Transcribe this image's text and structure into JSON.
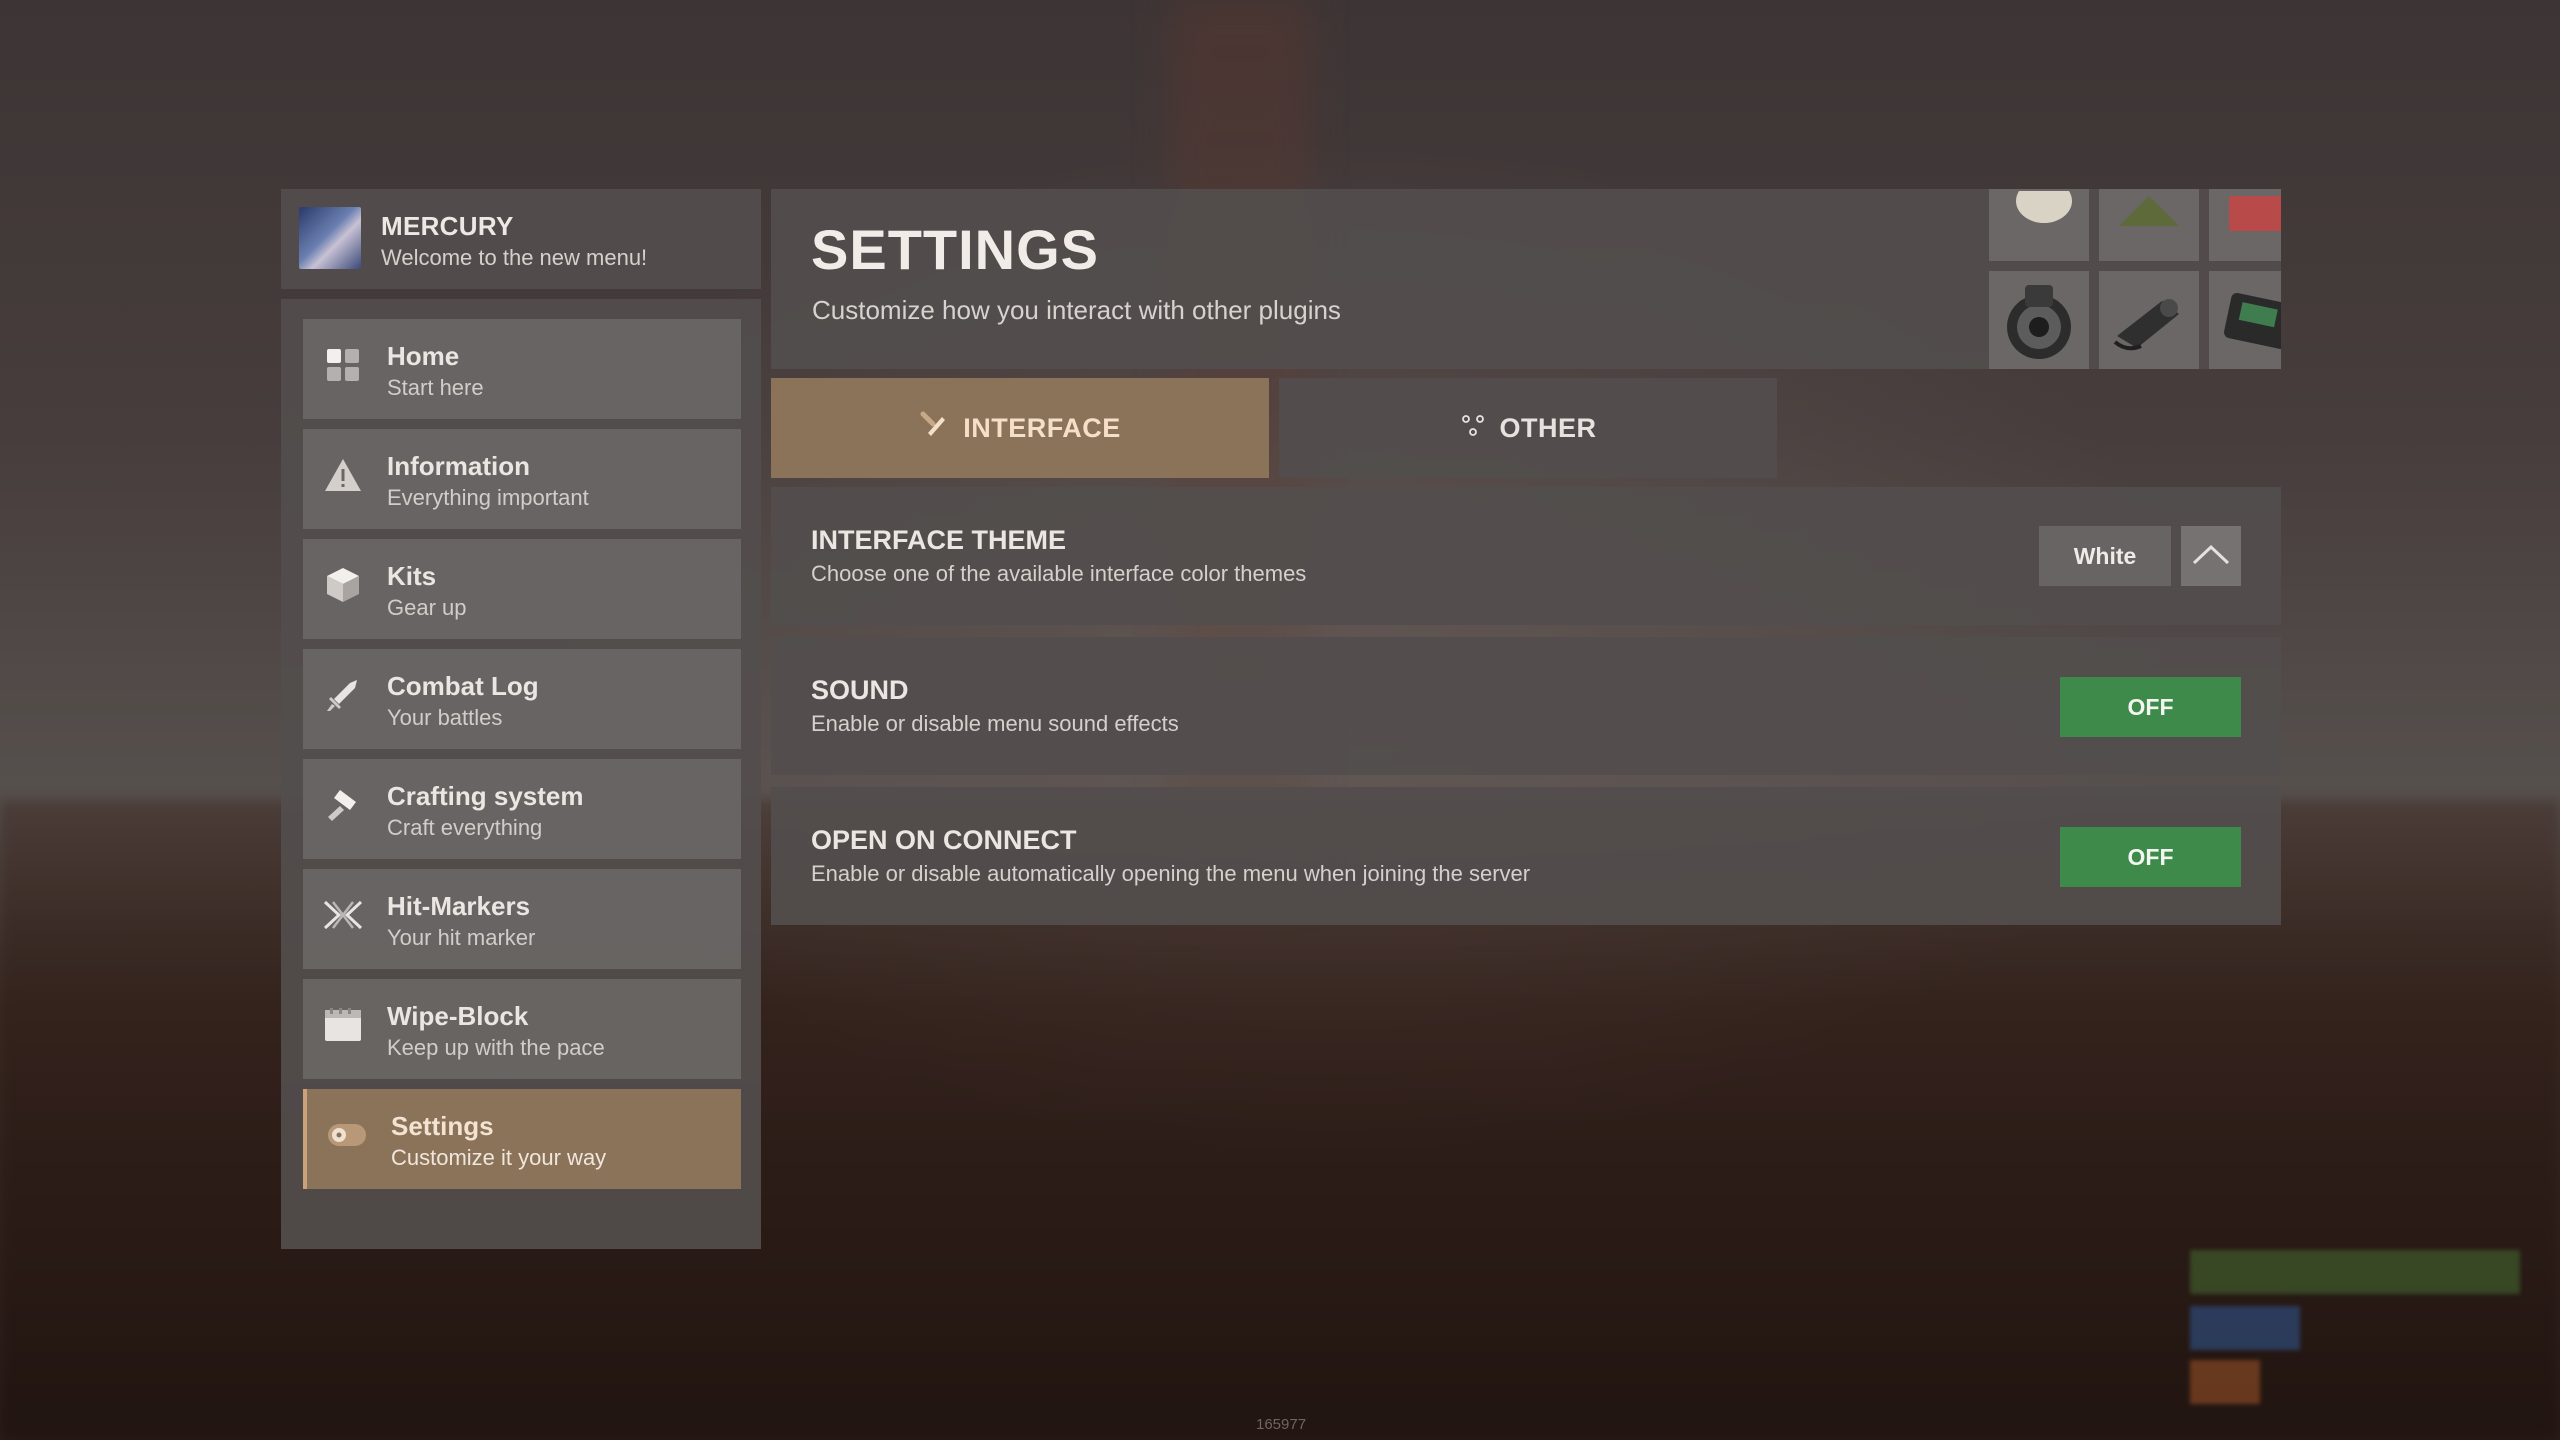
{
  "profile": {
    "name": "MERCURY",
    "subtitle": "Welcome to the new menu!"
  },
  "sidebar": {
    "items": [
      {
        "title": "Home",
        "subtitle": "Start here",
        "icon": "home-grid-icon"
      },
      {
        "title": "Information",
        "subtitle": "Everything important",
        "icon": "warning-icon"
      },
      {
        "title": "Kits",
        "subtitle": "Gear up",
        "icon": "box-icon"
      },
      {
        "title": "Combat Log",
        "subtitle": "Your battles",
        "icon": "sword-icon"
      },
      {
        "title": "Crafting system",
        "subtitle": "Craft everything",
        "icon": "hammer-icon"
      },
      {
        "title": "Hit-Markers",
        "subtitle": "Your hit marker",
        "icon": "crosshair-icon"
      },
      {
        "title": "Wipe-Block",
        "subtitle": "Keep up with the pace",
        "icon": "calendar-icon"
      },
      {
        "title": "Settings",
        "subtitle": "Customize it your way",
        "icon": "toggle-icon",
        "active": true
      }
    ]
  },
  "header": {
    "title": "SETTINGS",
    "subtitle": "Customize how you interact with other plugins"
  },
  "tabs": [
    {
      "label": "INTERFACE",
      "icon": "brush-icon",
      "active": true
    },
    {
      "label": "OTHER",
      "icon": "dots-icon",
      "active": false
    }
  ],
  "settings": {
    "theme": {
      "title": "INTERFACE THEME",
      "description": "Choose one of the available interface color themes",
      "value": "White"
    },
    "sound": {
      "title": "SOUND",
      "description": "Enable or disable menu sound effects",
      "value": "OFF"
    },
    "open_on_connect": {
      "title": "OPEN ON CONNECT",
      "description": "Enable or disable automatically opening the menu when joining the server",
      "value": "OFF"
    }
  },
  "background": {
    "version": "165977"
  },
  "colors": {
    "accent": "#8b735a",
    "toggle_off": "#3e8a4a",
    "panel": "#524e4d"
  }
}
